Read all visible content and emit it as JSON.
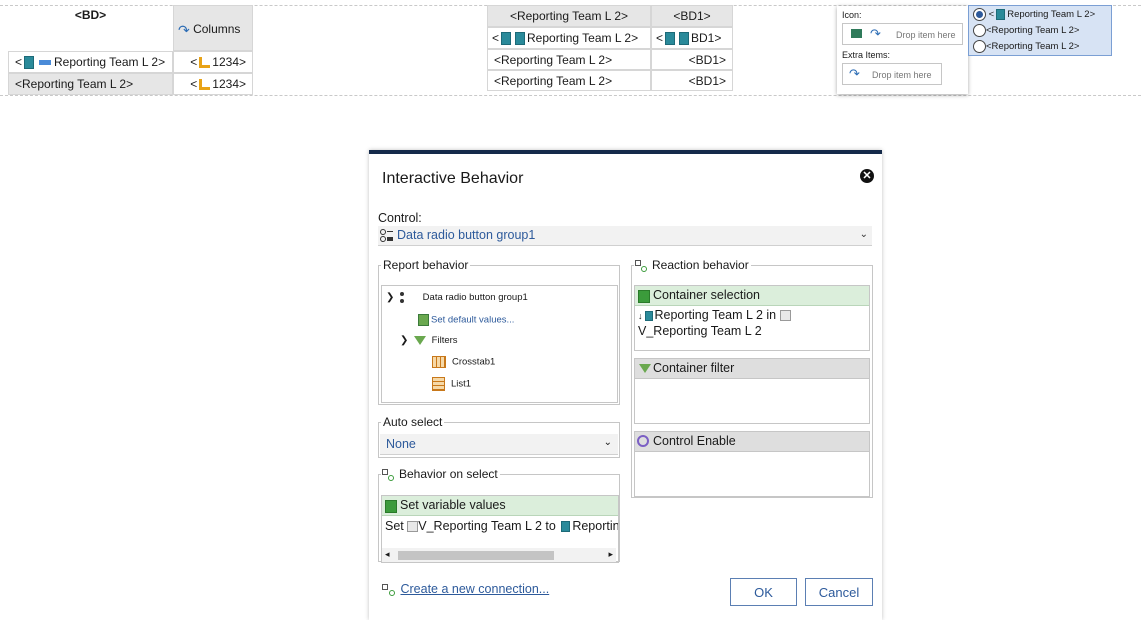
{
  "canvas": {
    "crosstab": {
      "corner": "<BD>",
      "columns_label": "Columns",
      "row1_label": "Reporting Team L 2>",
      "row1_prefix": "<",
      "row1_value": "1234>",
      "row2_label": "<Reporting Team L 2>",
      "row2_value": "1234>",
      "value_prefix": "<"
    },
    "list": {
      "headers": [
        "<Reporting Team L 2>",
        "<BD1>"
      ],
      "rows": [
        [
          "Reporting Team L 2>",
          "BD1>"
        ],
        [
          "<Reporting Team L 2>",
          "<BD1>"
        ],
        [
          "<Reporting Team L 2>",
          "<BD1>"
        ]
      ],
      "row1_prefix": "<"
    },
    "drop_panel": {
      "icon_label": "Icon:",
      "drop_here": "Drop item here",
      "extra_items_label": "Extra Items:",
      "drop_here_2": "Drop item here"
    },
    "radio_group": {
      "items": [
        "Reporting Team L 2>",
        "<Reporting Team L 2>",
        "<Reporting Team L 2>"
      ],
      "item1_prefix": "<"
    }
  },
  "dialog": {
    "title": "Interactive Behavior",
    "control_label": "Control:",
    "control_value": "Data radio button group1",
    "report_behavior": {
      "legend": "Report behavior",
      "tree": [
        "Data radio button group1",
        "Set default values...",
        "Filters",
        "Crosstab1",
        "List1"
      ]
    },
    "auto_select": {
      "legend": "Auto select",
      "value": "None"
    },
    "behavior_on_select": {
      "legend": "Behavior on select",
      "bar": "Set variable values",
      "content_set": "Set",
      "content_var": "V_Reporting Team L 2 to",
      "content_target": "Reporting"
    },
    "reaction_behavior": {
      "legend": "Reaction behavior",
      "container_selection": "Container selection",
      "cs_line1": "Reporting Team L 2 in",
      "cs_line2": "V_Reporting Team L 2",
      "container_filter": "Container filter",
      "control_enable": "Control Enable"
    },
    "create_link": "Create a new connection...",
    "ok": "OK",
    "cancel": "Cancel"
  },
  "colors": {
    "dialog_top_border": "#152a4a",
    "link": "#2d5a9b",
    "green_bar": "#dbeedb",
    "gray_bar": "#dedede"
  }
}
